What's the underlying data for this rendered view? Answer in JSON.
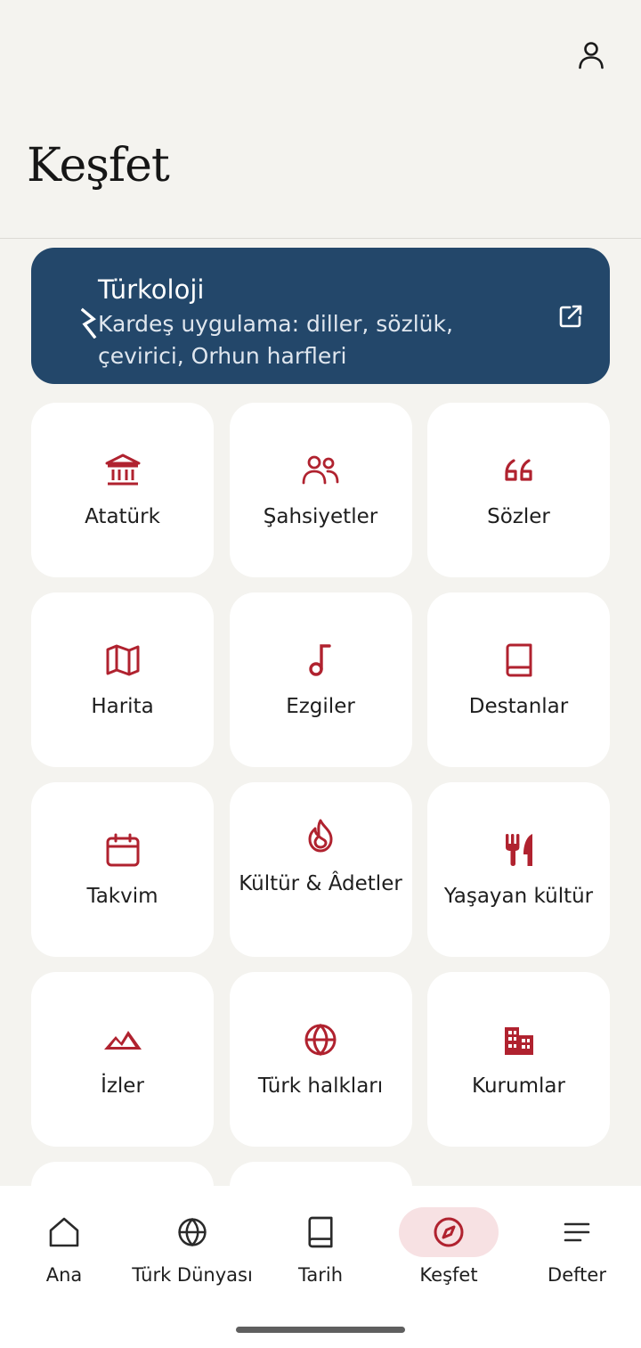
{
  "header": {
    "title": "Keşfet",
    "profile_icon": "person-icon"
  },
  "banner": {
    "title": "Türkoloji",
    "subtitle": "Kardeş uygulama: diller, sözlük, çevirici, Orhun harfleri",
    "glyph_icon": "orkhon-letter-icon",
    "action_icon": "external-link-icon",
    "background": "#23476a"
  },
  "accent_color": "#b0222f",
  "tiles": [
    {
      "label": "Atatürk",
      "icon": "museum-icon"
    },
    {
      "label": "Şahsiyetler",
      "icon": "people-icon"
    },
    {
      "label": "Sözler",
      "icon": "quote-icon"
    },
    {
      "label": "Harita",
      "icon": "map-icon"
    },
    {
      "label": "Ezgiler",
      "icon": "music-note-icon"
    },
    {
      "label": "Destanlar",
      "icon": "book-icon"
    },
    {
      "label": "Takvim",
      "icon": "calendar-icon"
    },
    {
      "label": "Kültür & Âdetler",
      "icon": "flame-icon"
    },
    {
      "label": "Yaşayan kültür",
      "icon": "utensils-icon"
    },
    {
      "label": "İzler",
      "icon": "mountain-icon"
    },
    {
      "label": "Türk halkları",
      "icon": "globe-icon"
    },
    {
      "label": "Kurumlar",
      "icon": "building-icon"
    }
  ],
  "bottom_nav": {
    "items": [
      {
        "label": "Ana",
        "icon": "home-icon",
        "active": false
      },
      {
        "label": "Türk Dünyası",
        "icon": "globe-icon",
        "active": false
      },
      {
        "label": "Tarih",
        "icon": "book-icon",
        "active": false
      },
      {
        "label": "Keşfet",
        "icon": "compass-icon",
        "active": true
      },
      {
        "label": "Defter",
        "icon": "menu-lines-icon",
        "active": false
      }
    ]
  }
}
